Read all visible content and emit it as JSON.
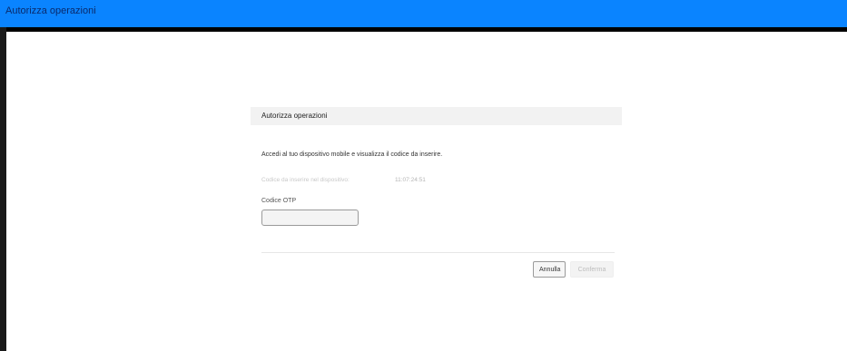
{
  "window": {
    "title": "Autorizza operazioni"
  },
  "dialog": {
    "header": "Autorizza operazioni",
    "instruction": "Accedi al tuo dispositivo mobile e visualizza il codice da inserire.",
    "code_label": "Codice da inserire nel dispositivo:",
    "code_value": "11:07:24:51",
    "otp_label": "Codice OTP",
    "otp_value": "",
    "otp_placeholder": "",
    "buttons": {
      "cancel": "Annulla",
      "confirm": "Conferma"
    }
  },
  "colors": {
    "titlebar": "#0a84ff",
    "border": "#000000"
  }
}
